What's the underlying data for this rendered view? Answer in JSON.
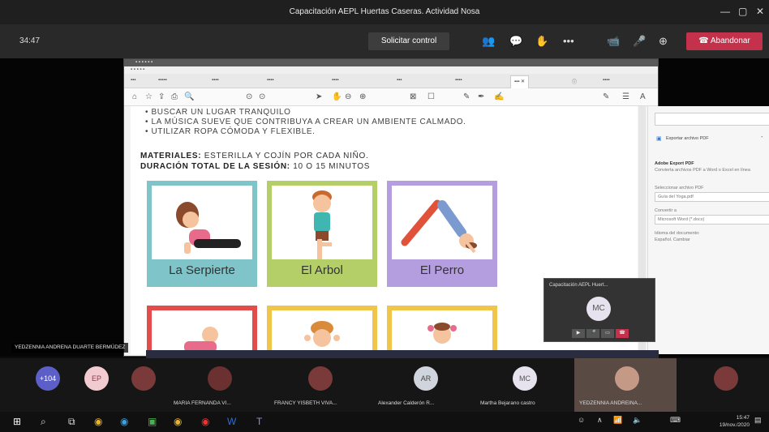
{
  "meeting": {
    "title": "Capacitación AEPL Huertas Caseras. Actividad Nosa",
    "timer": "34:47",
    "request_control": "Solicitar control",
    "leave": "Abandonar"
  },
  "pdf": {
    "bullets": [
      "BUSCAR UN LUGAR TRANQUILO",
      "LA MÚSICA SUEVE QUE CONTRIBUYA A CREAR UN AMBIENTE CALMADO.",
      "UTILIZAR ROPA CÓMODA Y FLEXIBLE."
    ],
    "materials_label": "MATERIALES:",
    "materials_text": "ESTERILLA Y COJÍN POR CADA NIÑO.",
    "duration_label": "DURACIÓN TOTAL DE LA SESIÓN:",
    "duration_text": "10 O 15 MINUTOS",
    "cards": [
      {
        "label": "La Serpierte",
        "color": "#7fc4c8"
      },
      {
        "label": "El Arbol",
        "color": "#b4cf68"
      },
      {
        "label": "El Perro",
        "color": "#b49ee0"
      }
    ],
    "lower_card_colors": [
      "#e44b4b",
      "#f1c44a",
      "#f1c44a"
    ],
    "side": {
      "export": "Exportar archivo PDF",
      "convert_title": "Adobe Export PDF",
      "convert_desc": "Convierta archivos PDF a Word o Excel en línea",
      "select_label": "Seleccionar archivo PDF",
      "file_name": "Guía del Yoga.pdf",
      "convert_to": "Convertir a",
      "format": "Microsoft Word (*.docx)",
      "language": "Idioma del documento:",
      "language_value": "Español. Cambiar"
    }
  },
  "mini": {
    "title": "Capacitación AEPL Huert...",
    "initials": "MC"
  },
  "name_tag": "YEDZENNIA ANDRENA DUARTE BERMÚDEZ",
  "participants": [
    {
      "initials": "+104",
      "color": "#5b5fc7",
      "name": ""
    },
    {
      "initials": "EP",
      "color": "#f2cbd1",
      "name": ""
    },
    {
      "initials": "",
      "color": "#7a3a3a",
      "name": ""
    },
    {
      "initials": "",
      "color": "#6b3030",
      "name": "MARIA FERNANDA VI..."
    },
    {
      "initials": "",
      "color": "#7a3a3a",
      "name": "FRANCY YISBETH VIVA..."
    },
    {
      "initials": "AR",
      "color": "#d0d4dc",
      "name": "Alexander Calderón R..."
    },
    {
      "initials": "MC",
      "color": "#e7e3ee",
      "name": "Martha Bejarano castro"
    },
    {
      "initials": "",
      "color": "#c49a86",
      "name": "YEDZENNIA ANDREINA..."
    },
    {
      "initials": "",
      "color": "#7a3a3a",
      "name": ""
    }
  ],
  "clock": {
    "time": "15:47",
    "date": "19/nov./2020"
  }
}
